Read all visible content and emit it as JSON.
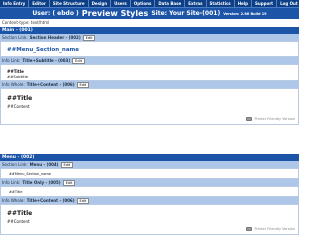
{
  "topnav": {
    "items": [
      "Info Entry",
      "Editor",
      "Site Structure",
      "Design",
      "Users",
      "Options",
      "Data Base",
      "Extras",
      "Statistics",
      "Help",
      "Support",
      "Log Out"
    ]
  },
  "header": {
    "user": "User: ( ebdo )",
    "title": "Preview Styles",
    "site": "Site: Your Site-(001)",
    "version": "Version: 2.86 Build 19"
  },
  "content_type": "Content-type: text/html",
  "section1": {
    "header": "Main - (001)",
    "link_label": "Section Link:",
    "link_value": "Section Header - (002)",
    "section_name": "##Menu_Section_name",
    "info_link_label": "Info Link:",
    "info_link_value": "Title+Subtitle - (003)",
    "title": "##Title",
    "subtitle": "##Subtitle",
    "info_whole_label": "Info Whole:",
    "info_whole_value": "Title+Content - (006)",
    "big_title": "##Title",
    "content": "##Content",
    "printer": "Printer Friendly Version"
  },
  "section2": {
    "header": "Menu - (002)",
    "link_label": "Section Link:",
    "link_value": "Menu - (004)",
    "section_name": "##Menu_Section_name",
    "info_link_label": "Info Link:",
    "info_link_value": "Title Only - (005)",
    "title": "##Title",
    "info_whole_label": "Info Whole:",
    "info_whole_value": "Title+Content - (006)",
    "big_title": "##Title",
    "content": "##Content",
    "printer": "Printer Friendly Version"
  },
  "edit_label": "Edit"
}
